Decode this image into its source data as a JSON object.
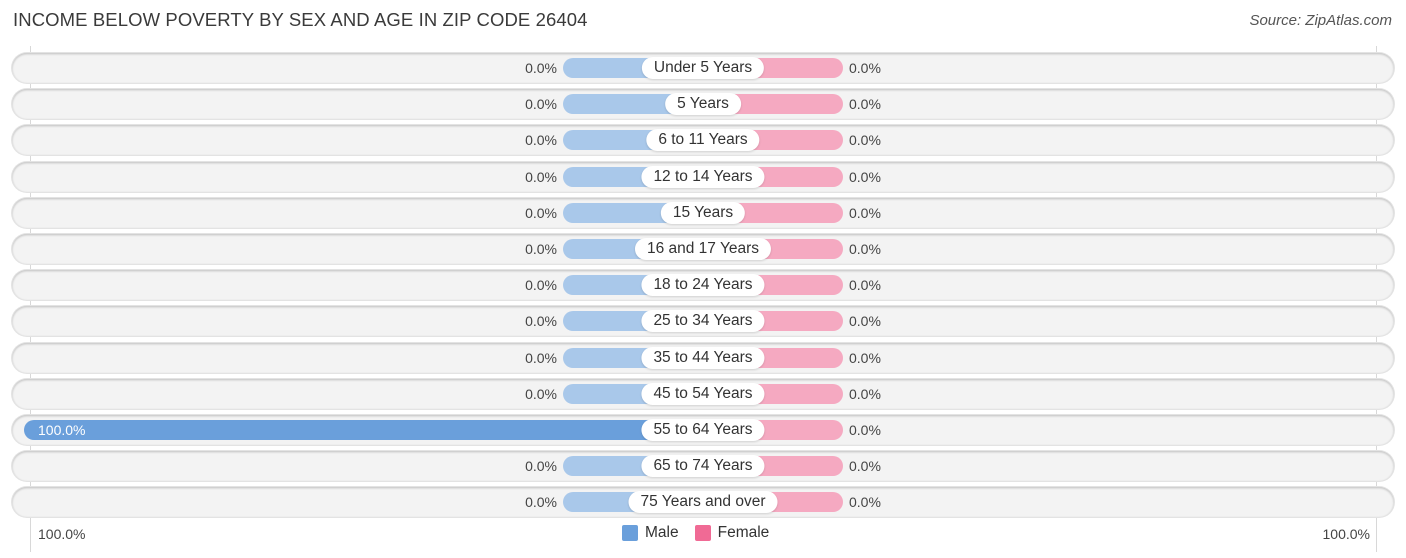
{
  "title": "INCOME BELOW POVERTY BY SEX AND AGE IN ZIP CODE 26404",
  "source": "Source: ZipAtlas.com",
  "colors": {
    "male_full": "#6a9fdb",
    "male_light": "#a9c8ea",
    "female_light": "#f5a9c1",
    "female_full": "#f06a95",
    "legend_male": "#6a9fdb",
    "legend_female": "#f06a95"
  },
  "axis": {
    "left_label": "100.0%",
    "right_label": "100.0%"
  },
  "legend": [
    {
      "label": "Male",
      "key": "male"
    },
    {
      "label": "Female",
      "key": "female"
    }
  ],
  "chart_data": {
    "type": "bar",
    "orientation": "horizontal-diverging",
    "title": "INCOME BELOW POVERTY BY SEX AND AGE IN ZIP CODE 26404",
    "xlabel": "",
    "ylabel": "",
    "xlim": [
      -100,
      100
    ],
    "legend_position": "bottom-center",
    "categories": [
      "Under 5 Years",
      "5 Years",
      "6 to 11 Years",
      "12 to 14 Years",
      "15 Years",
      "16 and 17 Years",
      "18 to 24 Years",
      "25 to 34 Years",
      "35 to 44 Years",
      "45 to 54 Years",
      "55 to 64 Years",
      "65 to 74 Years",
      "75 Years and over"
    ],
    "series": [
      {
        "name": "Male",
        "values": [
          0,
          0,
          0,
          0,
          0,
          0,
          0,
          0,
          0,
          0,
          100,
          0,
          0
        ],
        "labels": [
          "0.0%",
          "0.0%",
          "0.0%",
          "0.0%",
          "0.0%",
          "0.0%",
          "0.0%",
          "0.0%",
          "0.0%",
          "0.0%",
          "100.0%",
          "0.0%",
          "0.0%"
        ]
      },
      {
        "name": "Female",
        "values": [
          0,
          0,
          0,
          0,
          0,
          0,
          0,
          0,
          0,
          0,
          0,
          0,
          0
        ],
        "labels": [
          "0.0%",
          "0.0%",
          "0.0%",
          "0.0%",
          "0.0%",
          "0.0%",
          "0.0%",
          "0.0%",
          "0.0%",
          "0.0%",
          "0.0%",
          "0.0%",
          "0.0%"
        ]
      }
    ]
  }
}
